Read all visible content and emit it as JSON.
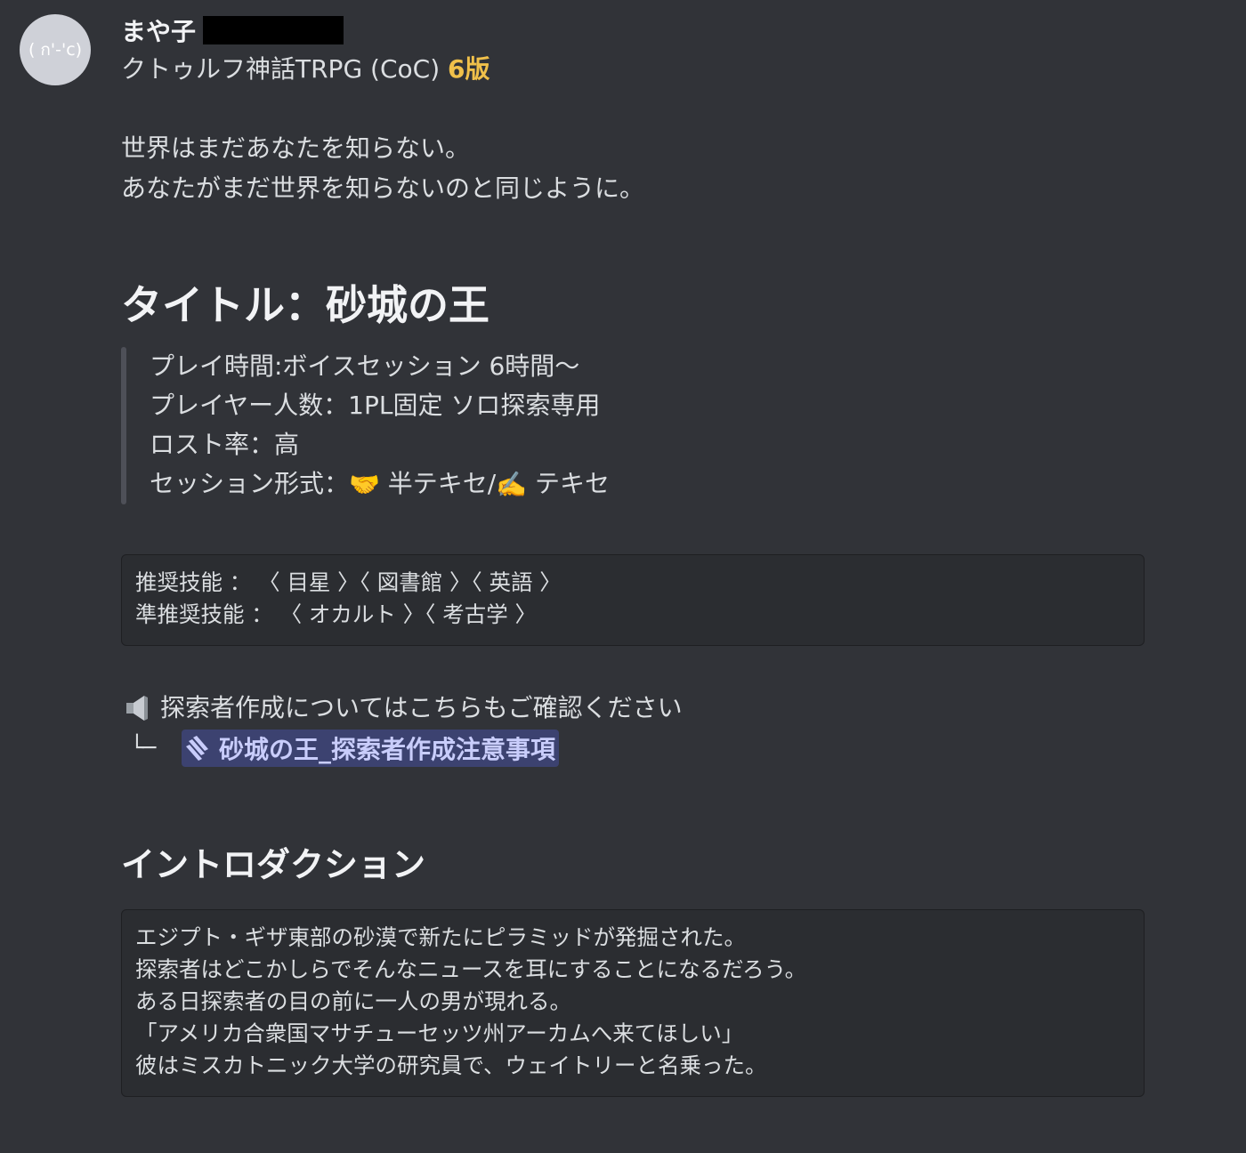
{
  "author": {
    "avatar_face": "( ก'-'c)",
    "name": "まや子",
    "name_redacted": true
  },
  "header_line": {
    "system": "クトゥルフ神話TRPG (CoC)",
    "edition": "6版"
  },
  "tagline": [
    "世界はまだあなたを知らない。",
    "あなたがまだ世界を知らないのと同じように。"
  ],
  "scenario_title": "タイトル：砂城の王",
  "details": {
    "play_time": "プレイ時間:ボイスセッション 6時間〜",
    "players": "プレイヤー人数：1PL固定 ソロ探索専用",
    "lost_rate": "ロスト率：高",
    "format_prefix": "セッション形式：",
    "format_emoji_1": "🤝",
    "format_semi": "半テキセ/",
    "format_emoji_2": "✍️",
    "format_text": "テキセ"
  },
  "skills": {
    "recommended": "推奨技能 ： 〈 目星 〉〈 図書館 〉〈 英語 〉",
    "semi_recommended": "準推奨技能 ： 〈 オカルト 〉〈 考古学 〉"
  },
  "notice": {
    "icon": "speaker-icon",
    "text": "探索者作成についてはこちらもご確認ください",
    "branch": "└─",
    "channel_icon": "forum-thread-icon",
    "channel_name": "砂城の王_探索者作成注意事項"
  },
  "intro": {
    "heading": "イントロダクション",
    "lines": [
      "エジプト・ギザ東部の砂漠で新たにピラミッドが発掘された。",
      "探索者はどこかしらでそんなニュースを耳にすることになるだろう。",
      "ある日探索者の目の前に一人の男が現れる。",
      "「アメリカ合衆国マサチューセッツ州アーカムへ来てほしい」",
      "彼はミスカトニック大学の研究員で、ウェイトリーと名乗った。"
    ]
  },
  "colors": {
    "background": "#313338",
    "edition_gold": "#f0c04a",
    "mention_bg": "#3c4270",
    "mention_text": "#c9cdfb"
  }
}
